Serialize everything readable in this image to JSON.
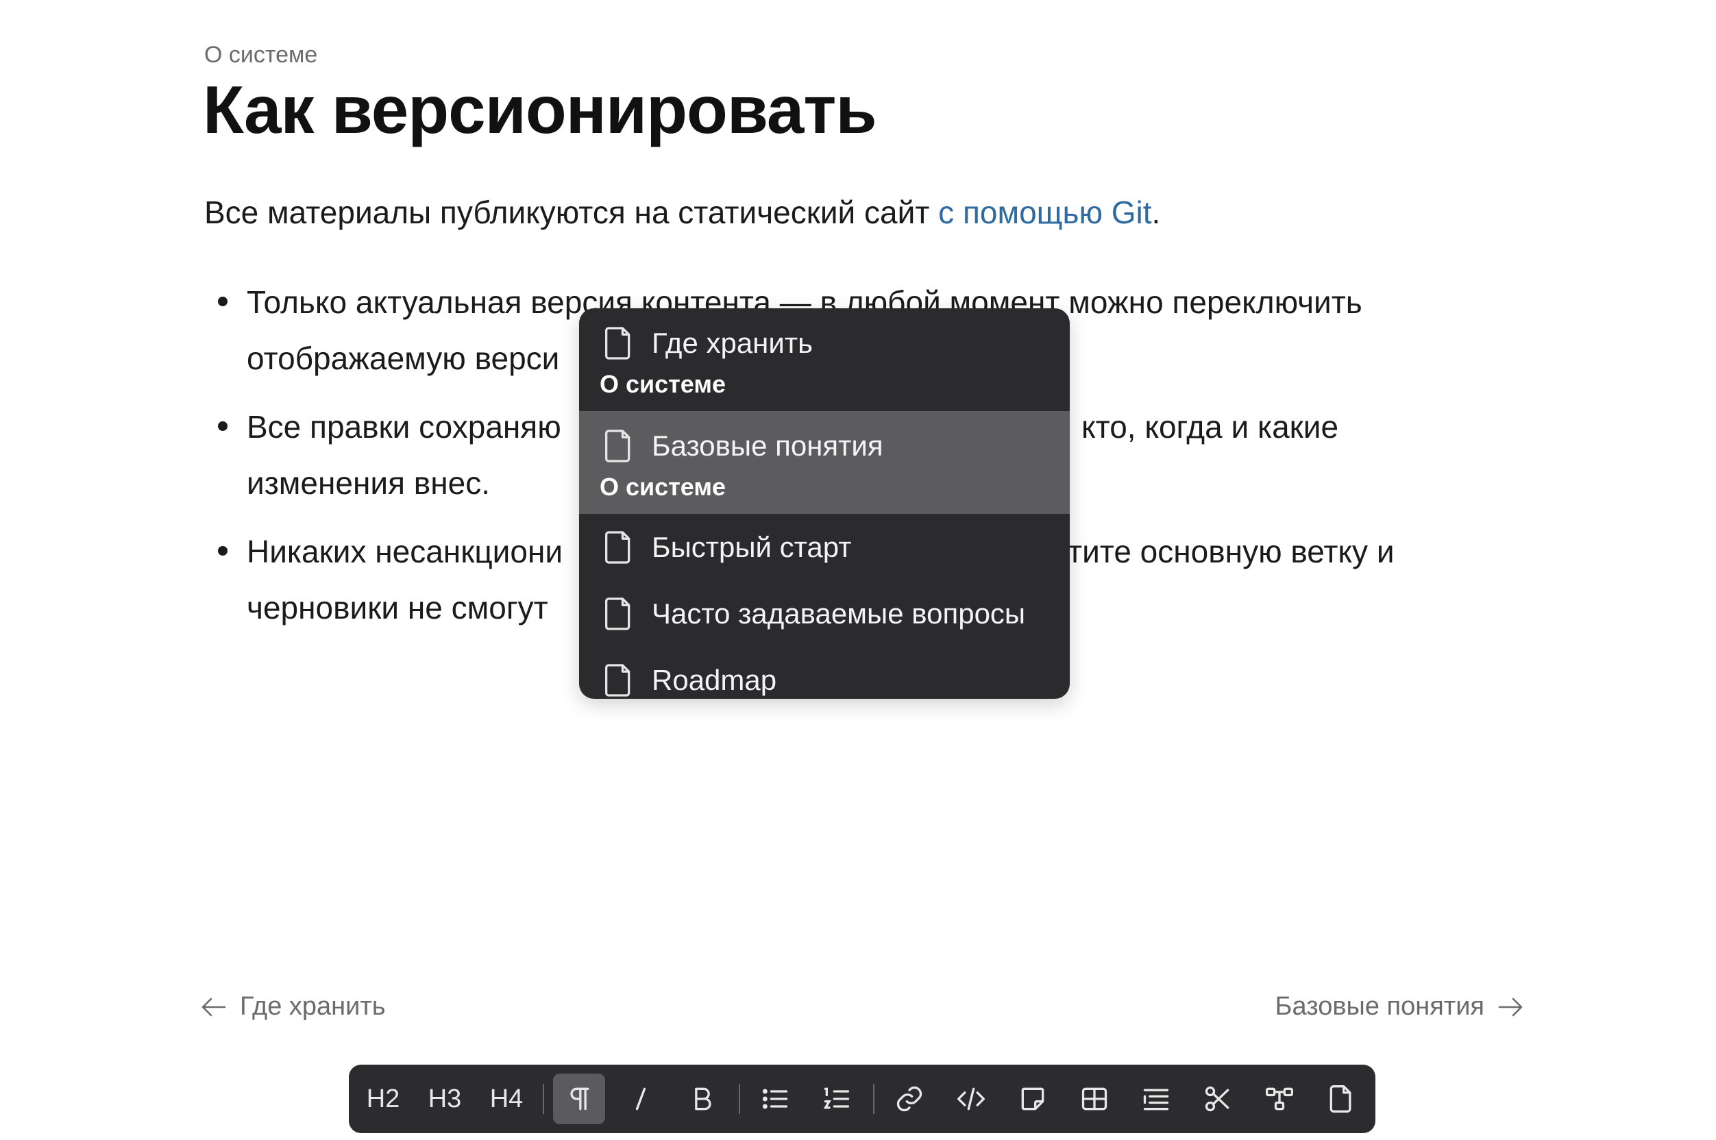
{
  "breadcrumb": "О системе",
  "title": "Как версионировать",
  "intro": {
    "text": "Все материалы публикуются на статический сайт ",
    "link": "с помощью Git",
    "end": "."
  },
  "bullets": [
    "Только актуальная версия контента — в любой момент можно переключить отображаемую верси",
    "Все правки сохраняю",
    "изменения внес.",
    "Никаких несанкциони",
    "черновики не смогут"
  ],
  "bullet_tails": [
    "кто, когда и какие",
    "тите основную ветку и"
  ],
  "popup": {
    "items": [
      {
        "label": "Где хранить",
        "sub": "О системе",
        "icon": "document-icon"
      },
      {
        "label": "Базовые понятия",
        "sub": "О системе",
        "icon": "document-icon",
        "selected": true
      },
      {
        "label": "Быстрый старт",
        "icon": "document-icon"
      },
      {
        "label": "Часто задаваемые вопросы",
        "icon": "document-icon"
      },
      {
        "label": "Roadmap",
        "icon": "document-icon"
      }
    ]
  },
  "nav": {
    "prev": "Где хранить",
    "next": "Базовые понятия"
  },
  "toolbar": {
    "h2": "H2",
    "h3": "H3",
    "h4": "H4",
    "icons": [
      "paragraph-icon",
      "italic-icon",
      "bold-icon",
      "bullet-list-icon",
      "numbered-list-icon",
      "link-icon",
      "code-icon",
      "note-icon",
      "table-icon",
      "outline-icon",
      "cut-icon",
      "diagram-icon",
      "page-icon"
    ]
  },
  "colors": {
    "link": "#2f6aa1",
    "popup_bg": "#2b2b2d",
    "popup_selected": "#5c5c5e",
    "toolbar_bg": "#2c2c2e",
    "toolbar_active": "#5b5b5e"
  }
}
